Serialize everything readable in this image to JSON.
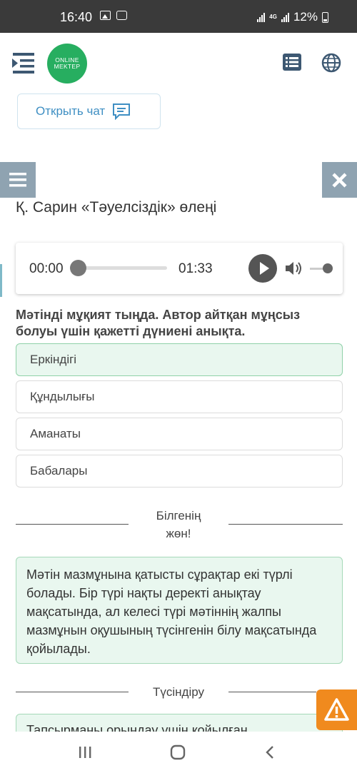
{
  "status_bar": {
    "time": "16:40",
    "network": "4G",
    "battery": "12%"
  },
  "header": {
    "logo_line1": "ONLINE",
    "logo_line2": "MEKTEP"
  },
  "chat_button": {
    "label": "Открыть чат"
  },
  "lesson": {
    "title": "Қ. Сарин «Тәуелсіздік» өлеңі",
    "audio": {
      "current_time": "00:00",
      "duration": "01:33",
      "progress": 0
    },
    "question": "Мәтінді мұқият тыңда. Автор айтқан мұңсыз болуы үшін қажетті дүниені анықта.",
    "options": [
      {
        "label": "Еркіндігі",
        "selected": true
      },
      {
        "label": "Құндылығы",
        "selected": false
      },
      {
        "label": "Аманаты",
        "selected": false
      },
      {
        "label": "Бабалары",
        "selected": false
      }
    ],
    "know_section": {
      "heading_line1": "Білгенің",
      "heading_line2": "жөн!",
      "text": "Мәтін мазмұнына қатысты сұрақтар екі түрлі болады. Бір түрі нақты деректі анықтау мақсатында, ал келесі түрі мәтіннің жалпы мазмұнын оқушының түсінгенін білу мақсатында қойылады."
    },
    "explain_section": {
      "heading": "Түсіндіру",
      "text_partial": "Тапсырманы орындау үшін қойылған"
    }
  },
  "colors": {
    "accent": "#3f8fc3",
    "brand": "#27ae60",
    "selected_bg": "#e9f7ef",
    "warning": "#f08a1e",
    "side_button": "#8fa3b1"
  }
}
